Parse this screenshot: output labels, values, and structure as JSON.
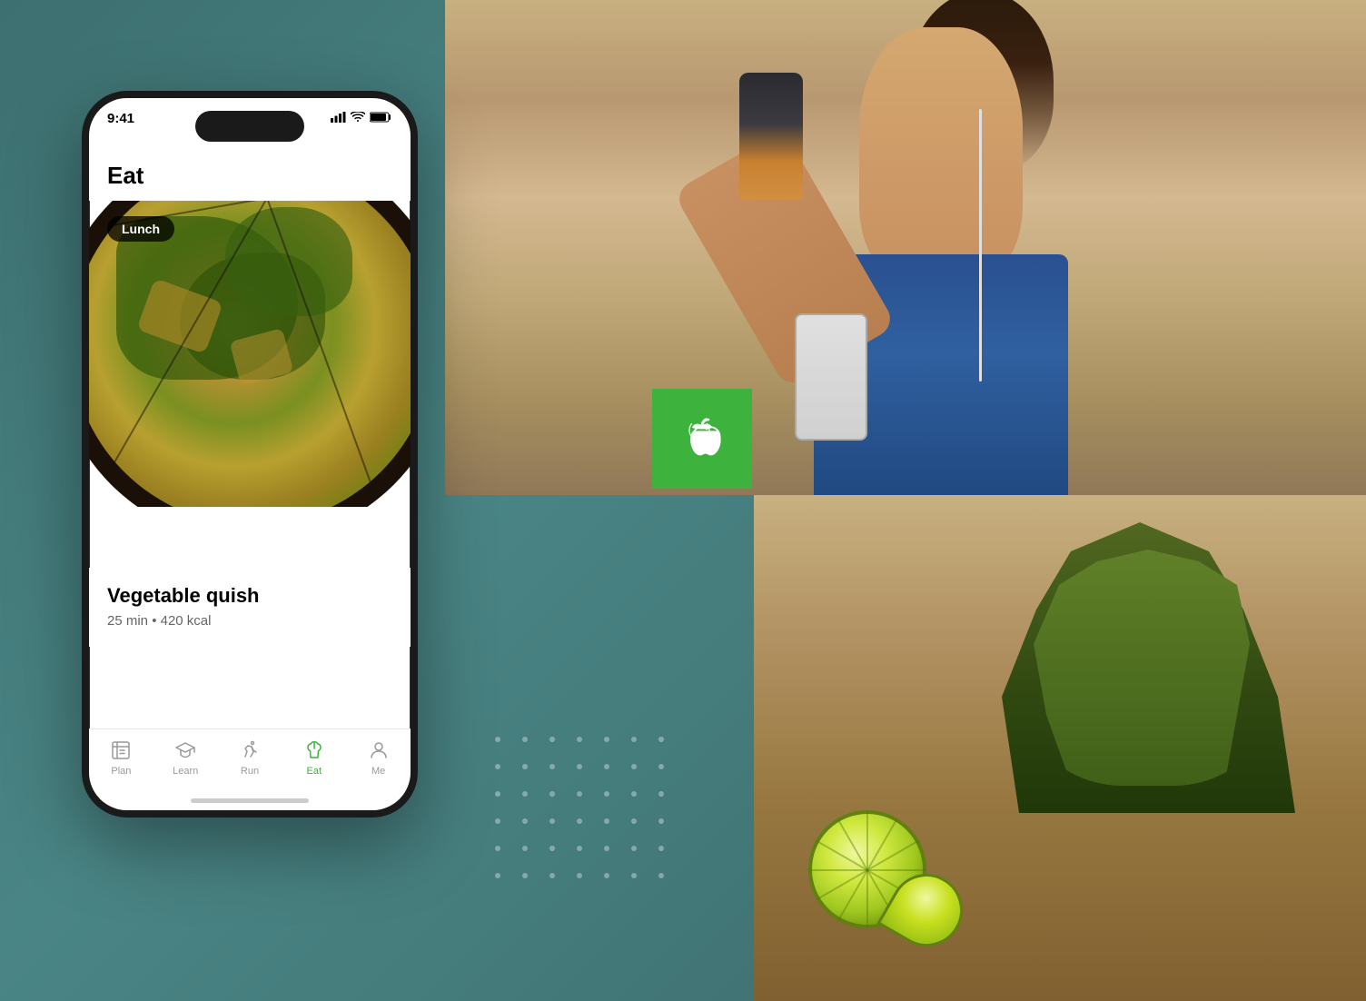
{
  "background": {
    "color": "#4a7a7a"
  },
  "phone": {
    "status_time": "9:41",
    "header_title": "Eat",
    "food_card": {
      "meal_badge": "Lunch",
      "food_name": "Vegetable quish",
      "food_time": "25 min",
      "food_calories": "420 kcal",
      "food_meta": "25 min • 420 kcal"
    },
    "bottom_nav": {
      "items": [
        {
          "label": "Plan",
          "active": false
        },
        {
          "label": "Learn",
          "active": false
        },
        {
          "label": "Run",
          "active": false
        },
        {
          "label": "Eat",
          "active": true
        },
        {
          "label": "Me",
          "active": false
        }
      ]
    }
  },
  "app_icon": {
    "type": "apple",
    "color": "#3db33d"
  },
  "dots": {
    "color": "rgba(255,255,255,0.35)"
  }
}
